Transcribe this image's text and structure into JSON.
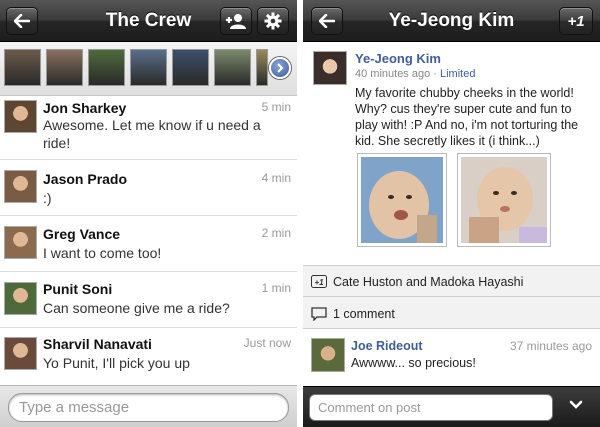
{
  "left": {
    "title": "The Crew",
    "icons": {
      "back": "back-arrow-icon",
      "add_person": "add-person-icon",
      "settings": "gear-icon",
      "more": "chevron-right-icon"
    },
    "strip_avatars": [
      {
        "name": "avatar-1",
        "color": "#6b5a4a"
      },
      {
        "name": "avatar-2",
        "color": "#8a7060"
      },
      {
        "name": "avatar-3",
        "color": "#4f6b3d"
      },
      {
        "name": "avatar-4",
        "color": "#5a6f8a"
      },
      {
        "name": "avatar-5",
        "color": "#3d4f6b"
      },
      {
        "name": "avatar-6",
        "color": "#7a8a6b"
      },
      {
        "name": "avatar-7",
        "color": "#9a8a5a"
      }
    ],
    "messages": [
      {
        "sender": "Jon Sharkey",
        "time": "5 min",
        "text": "Awesome. Let me know if u need a ride!",
        "avatar_color": "#5e4632"
      },
      {
        "sender": "Jason Prado",
        "time": "4 min",
        "text": ":)",
        "avatar_color": "#7a5b44"
      },
      {
        "sender": "Greg Vance",
        "time": "2 min",
        "text": "I want to come too!",
        "avatar_color": "#8b6a4e"
      },
      {
        "sender": "Punit Soni",
        "time": "1 min",
        "text": "Can someone give me a ride?",
        "avatar_color": "#4f6a3a"
      },
      {
        "sender": "Sharvil Nanavati",
        "time": "Just now",
        "text": "Yo Punit, I'll pick you up",
        "avatar_color": "#6a4a3a"
      }
    ],
    "composer_placeholder": "Type a message"
  },
  "right": {
    "title": "Ye-Jeong Kim",
    "plus_one_label": "+1",
    "icons": {
      "back": "back-arrow-icon",
      "plus_ones": "plus-one-icon",
      "comments": "comment-icon",
      "chevron": "chevron-down-icon"
    },
    "post": {
      "author": "Ye-Jeong Kim",
      "time": "40 minutes ago",
      "visibility": "Limited",
      "text": "My favorite chubby cheeks in the world! Why? cus they're super cute and fun to play with! :P And no, i'm not torturing the kid. She secretly likes it (i think...)",
      "photos": [
        {
          "name": "baby-photo-1",
          "color": "#c9b7a6"
        },
        {
          "name": "baby-photo-2",
          "color": "#d7c0ae"
        }
      ]
    },
    "plus_ones_text": "Cate Huston and Madoka Hayashi",
    "comments_count_text": "1 comment",
    "comment": {
      "author": "Joe Rideout",
      "time": "37 minutes ago",
      "text": "Awwww... so precious!"
    },
    "comment_placeholder": "Comment on post"
  }
}
